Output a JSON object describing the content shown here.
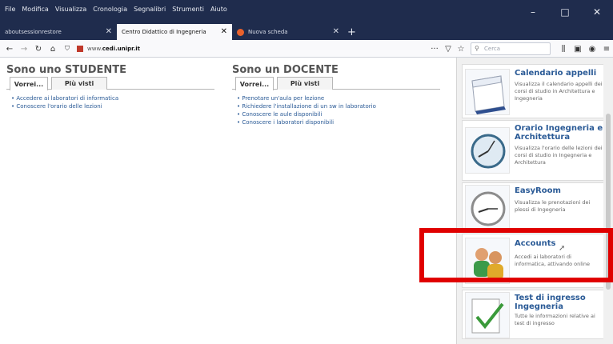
{
  "menu": [
    "File",
    "Modifica",
    "Visualizza",
    "Cronologia",
    "Segnalibri",
    "Strumenti",
    "Aiuto"
  ],
  "window_controls": {
    "minimize": "–",
    "maximize": "□",
    "close": "✕"
  },
  "tabs": [
    {
      "label": "aboutsessionrestore",
      "close": "✕"
    },
    {
      "label": "Centro Didattico di Ingegneria",
      "close": "✕"
    },
    {
      "label": "Nuova scheda",
      "close": "✕"
    }
  ],
  "newtab": "+",
  "nav": {
    "url_prefix": "www.",
    "url_host": "cedi.unipr.it",
    "more": "···",
    "search_placeholder": "Cerca"
  },
  "student": {
    "title": "Sono uno STUDENTE",
    "tab1": "Vorrei...",
    "tab2": "Più visti",
    "links": [
      "Accedere ai laboratori di informatica",
      "Conoscere l'orario delle lezioni"
    ]
  },
  "teacher": {
    "title": "Sono un DOCENTE",
    "tab1": "Vorrei...",
    "tab2": "Più visti",
    "links": [
      "Prenotare un'aula per lezione",
      "Richiedere l'installazione di un sw in laboratorio",
      "Conoscere le aule disponibili",
      "Conoscere i laboratori disponibili"
    ]
  },
  "cards": [
    {
      "title": "Calendario appelli",
      "desc": "Visualizza il calendario appelli dei corsi di studio in Architettura e Ingegneria",
      "icon": "calendar-icon"
    },
    {
      "title": "Orario Ingegneria e Architettura",
      "desc": "Visualizza l'orario delle lezioni dei corsi di studio in Ingegneria e Architettura",
      "icon": "clock-icon"
    },
    {
      "title": "EasyRoom",
      "desc": "Visualizza le prenotazioni dei plessi di Ingegneria",
      "icon": "clock-icon"
    },
    {
      "title": "Accounts",
      "desc": "Accedi ai laboratori di informatica, attivando online",
      "icon": "users-icon"
    },
    {
      "title": "Test di ingresso Ingegneria",
      "desc": "Tutte le informazioni relative ai test di ingresso",
      "icon": "checklist-icon"
    }
  ],
  "colors": {
    "highlight": "#e00000",
    "link": "#2a5a96",
    "titlebar": "#1f2c4d"
  }
}
